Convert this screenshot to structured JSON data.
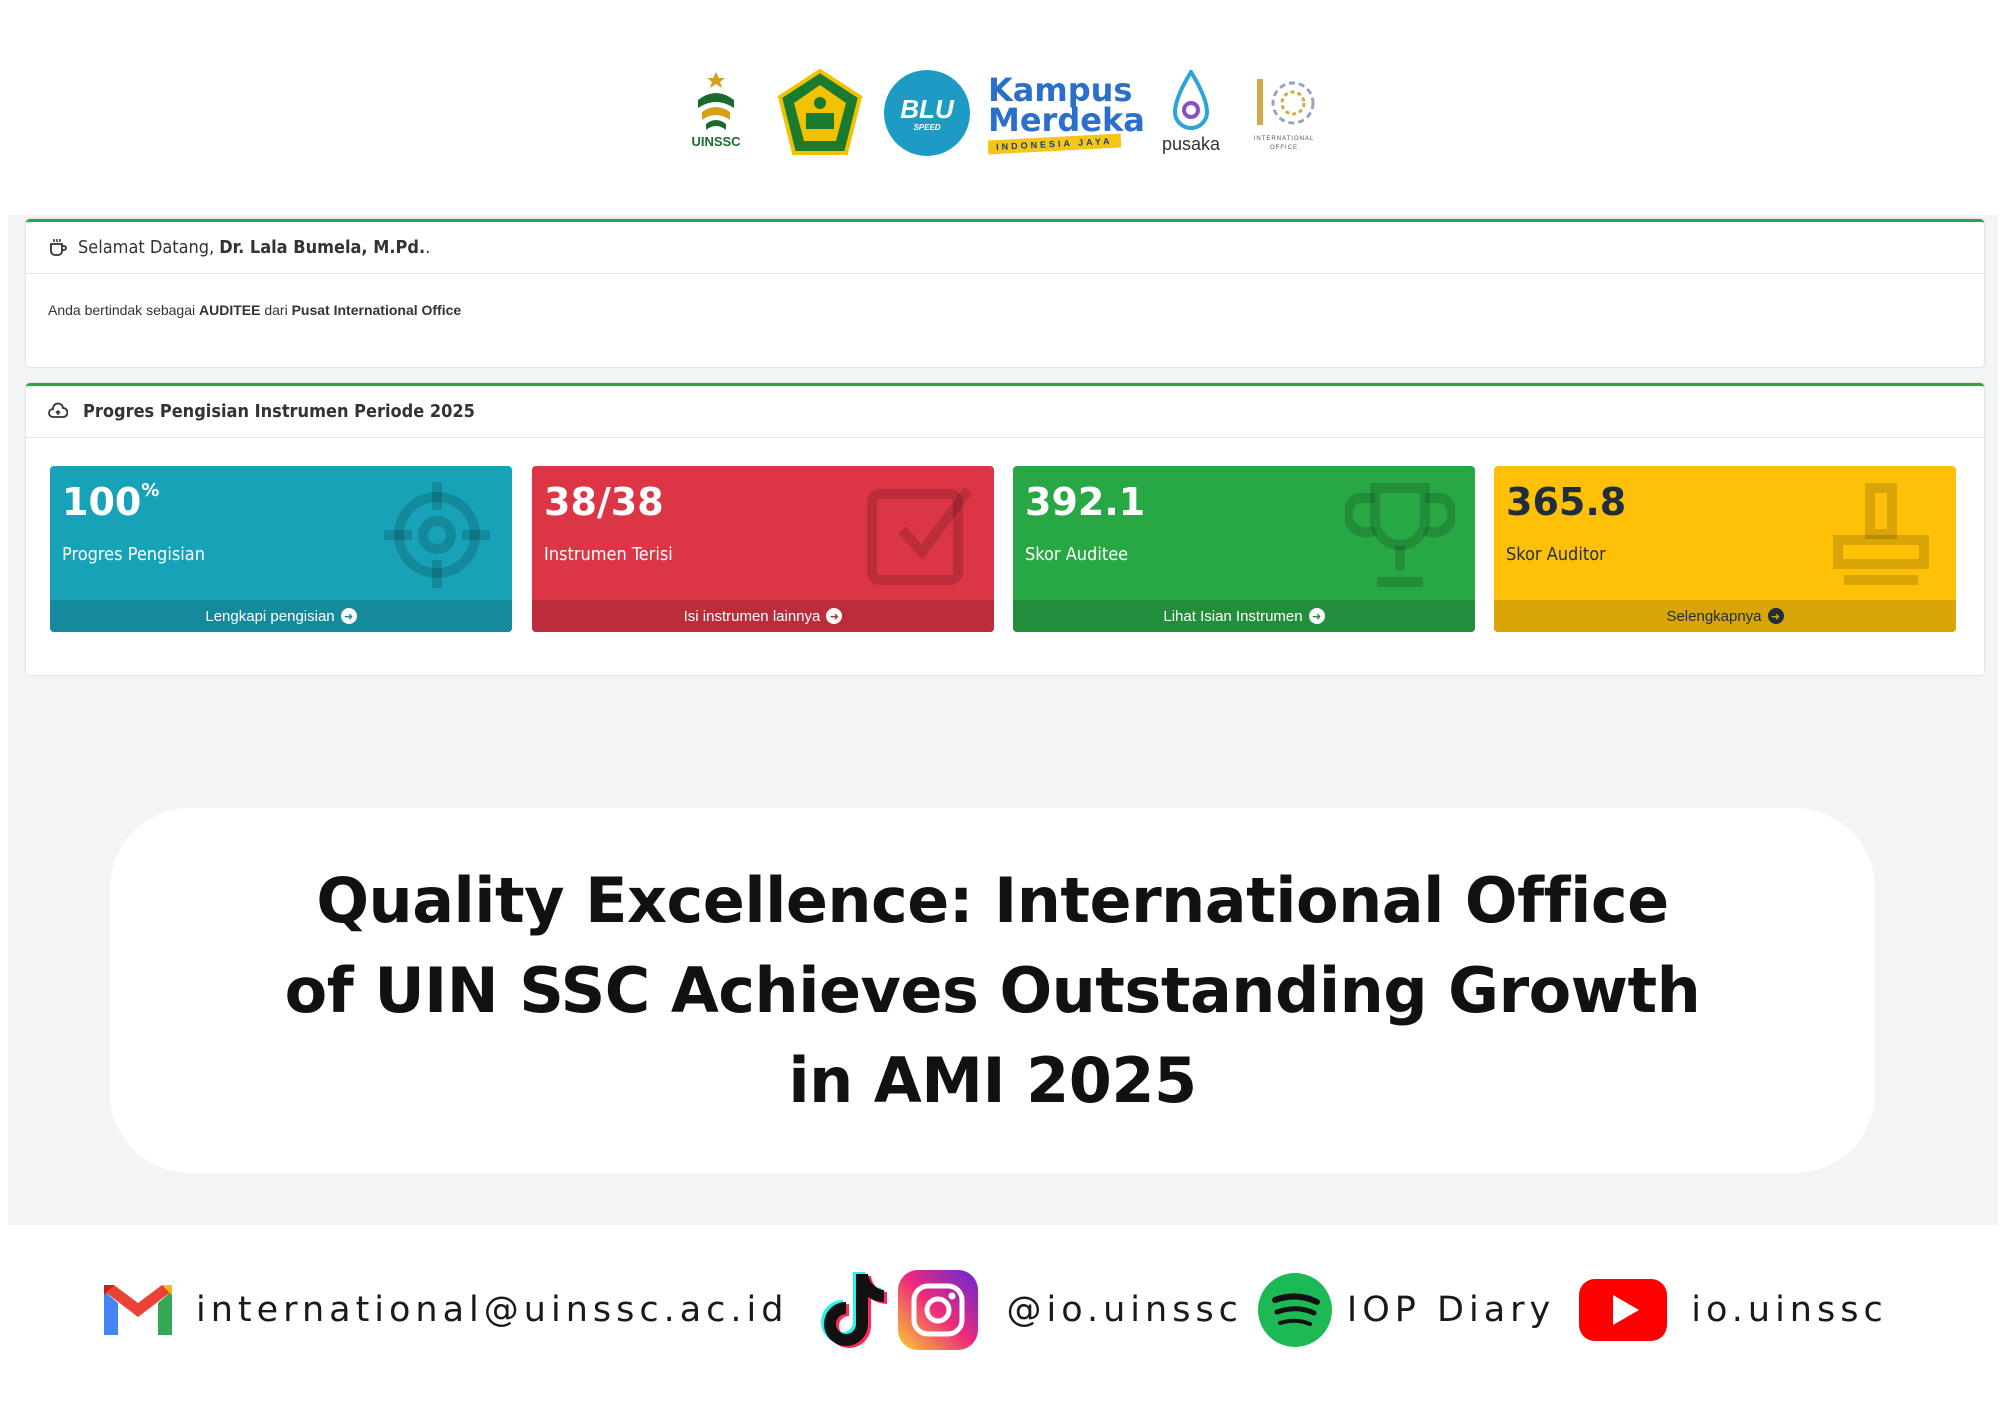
{
  "logos": {
    "uinssc": "UINSSC",
    "blu": "BLU",
    "blu_sub": "SPEED",
    "kampus_line1": "Kampus",
    "kampus_line2": "Merdeka",
    "kampus_line3": "INDONESIA JAYA",
    "pusaka": "pusaka",
    "io_line1": "INTERNATIONAL",
    "io_line2": "OFFICE"
  },
  "welcome": {
    "greeting": "Selamat Datang,",
    "user_name": "Dr. Lala Bumela, M.Pd.",
    "user_suffix": ".",
    "role_prefix": "Anda bertindak sebagai",
    "role": "AUDITEE",
    "unit_prefix": "dari",
    "unit": "Pusat International Office"
  },
  "progress": {
    "title": "Progres Pengisian Instrumen Periode 2025",
    "boxes": [
      {
        "value": "100",
        "value_suffix": "%",
        "label": "Progres Pengisian",
        "link": "Lengkapi pengisian",
        "icon": "crosshairs-icon"
      },
      {
        "value": "38/38",
        "label": "Instrumen Terisi",
        "link": "Isi instrumen lainnya",
        "icon": "check-square-icon"
      },
      {
        "value": "392.1",
        "label": "Skor Auditee",
        "link": "Lihat Isian Instrumen",
        "icon": "trophy-icon"
      },
      {
        "value": "365.8",
        "label": "Skor Auditor",
        "link": "Selengkapnya",
        "icon": "stamp-icon"
      }
    ],
    "colors": {
      "info": "#17a2b8",
      "danger": "#dc3545",
      "success": "#28a745",
      "warning": "#ffc107"
    }
  },
  "headline": {
    "line1": "Quality Excellence: International Office",
    "line2": "of UIN SSC Achieves Outstanding Growth",
    "line3": "in AMI 2025"
  },
  "footer": {
    "email": "international@uinssc.ac.id",
    "instagram": "@io.uinssc",
    "spotify": "IOP Diary",
    "youtube": "io.uinssc"
  }
}
